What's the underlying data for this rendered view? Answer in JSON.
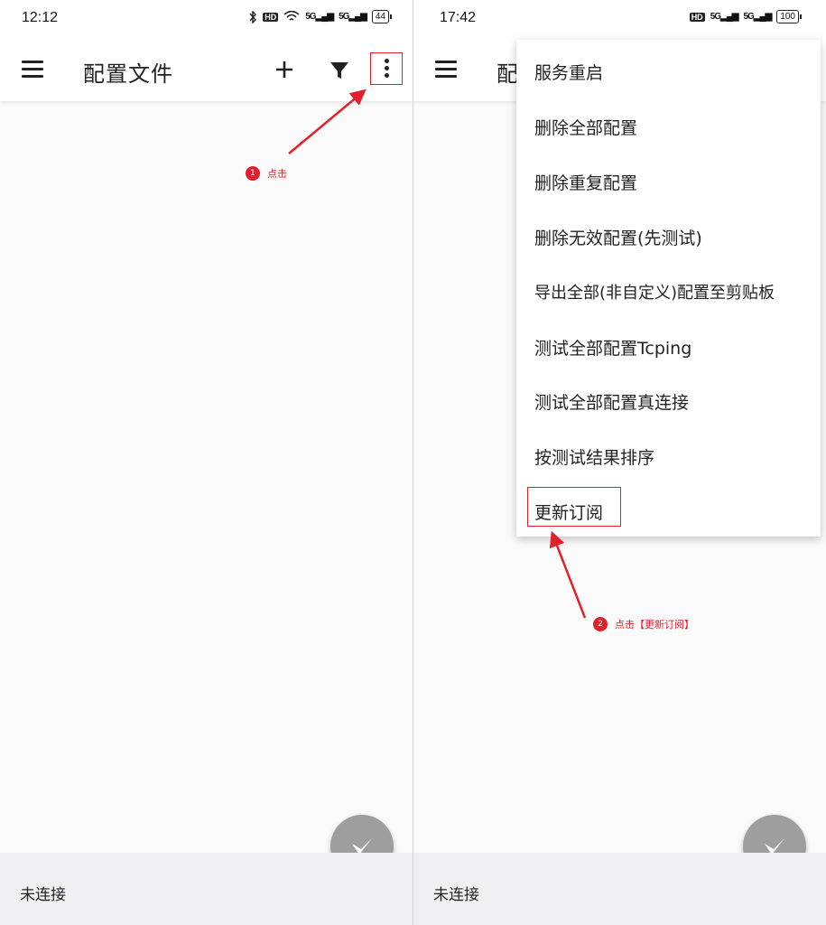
{
  "left_screen": {
    "status": {
      "time": "12:12",
      "hd": "HD",
      "sig1": "5G",
      "sig2": "5G",
      "battery": "44"
    },
    "appbar": {
      "title": "配置文件"
    },
    "bottom": {
      "status_text": "未连接"
    }
  },
  "right_screen": {
    "status": {
      "time": "17:42",
      "hd": "HD",
      "sig1": "5G",
      "sig2": "5G",
      "battery": "100"
    },
    "appbar": {
      "title_partial": "配"
    },
    "menu": {
      "items": [
        "服务重启",
        "删除全部配置",
        "删除重复配置",
        "删除无效配置(先测试)",
        "导出全部(非自定义)配置至剪贴板",
        "测试全部配置Tcping",
        "测试全部配置真连接",
        "按测试结果排序",
        "更新订阅"
      ]
    },
    "bottom": {
      "status_text": "未连接"
    }
  },
  "annotations": {
    "step1": {
      "number": "1",
      "text": "点击"
    },
    "step2": {
      "number": "2",
      "text": "点击【更新订阅】"
    }
  },
  "colors": {
    "annotation": "#e0202a",
    "fab": "#9e9e9e",
    "bottombar": "#f0f0f3"
  },
  "icons": [
    "hamburger-icon",
    "plus-icon",
    "filter-icon",
    "more-vert-icon",
    "v-logo-icon",
    "bluetooth-icon",
    "wifi-icon"
  ]
}
